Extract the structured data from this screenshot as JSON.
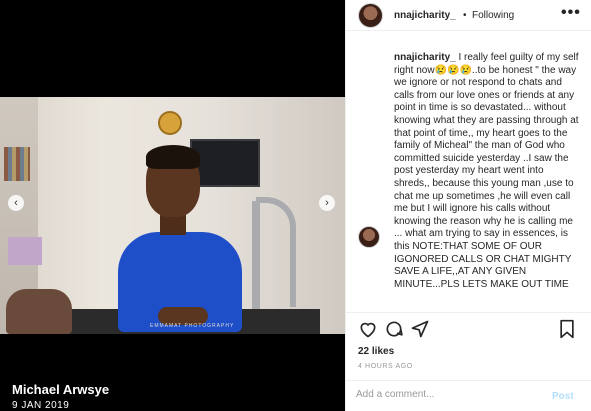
{
  "media": {
    "caption_name": "Michael Arwsye",
    "caption_date": "9 JAN 2019",
    "photo_watermark": "EMMAMAT PHOTOGRAPHY"
  },
  "header": {
    "username": "nnajicharity_",
    "separator": "•",
    "follow_status": "Following",
    "more": "•••"
  },
  "comment": {
    "username": "nnajicharity_",
    "text": " I really feel guilty of my self right now😢😢😢..to be honest \" the way we ignore or not respond to chats and calls from our love ones or friends at any point in time is so devastated... without knowing what they are passing through at that point of time,, my heart goes to the family of Micheal\" the man of God who committed suicide yesterday ..I saw the post yesterday my heart went into shreds,, because this young man ,use to chat me up sometimes ,he will even call me but I will ignore his calls without knowing the reason why he is calling me ... what am trying to say in essences, is this NOTE:THAT SOME OF OUR IGONORED CALLS OR CHAT MIGHTY SAVE A LIFE,,AT ANY GIVEN MINUTE...PLS LETS MAKE OUT TIME"
  },
  "nav": {
    "prev": "‹",
    "next": "›"
  },
  "stats": {
    "likes": "22 likes",
    "time": "4 HOURS AGO"
  },
  "add_comment": {
    "placeholder": "Add a comment...",
    "post_label": "Post"
  }
}
